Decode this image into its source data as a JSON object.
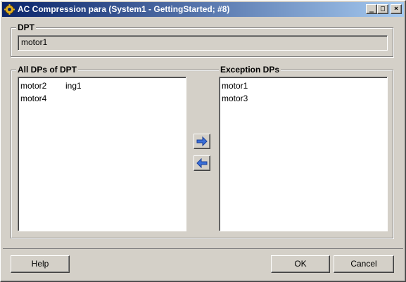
{
  "window": {
    "title": "AC Compression para (System1 - GettingStarted; #8)",
    "controls": {
      "minimize": "_",
      "maximize": "□",
      "close": "×"
    }
  },
  "dpt": {
    "group_label": "DPT",
    "value": "motor1"
  },
  "all_dps": {
    "group_label": "All DPs of DPT",
    "items": [
      {
        "label": "motor2",
        "extra": "ing1"
      },
      {
        "label": "motor4",
        "extra": ""
      }
    ]
  },
  "exception_dps": {
    "group_label": "Exception DPs",
    "items": [
      {
        "label": "motor1"
      },
      {
        "label": "motor3"
      }
    ]
  },
  "transfer": {
    "add_icon": "arrow-right-icon",
    "remove_icon": "arrow-left-icon",
    "arrow_color": "#3a6fd8"
  },
  "buttons": {
    "help": "Help",
    "ok": "OK",
    "cancel": "Cancel"
  }
}
